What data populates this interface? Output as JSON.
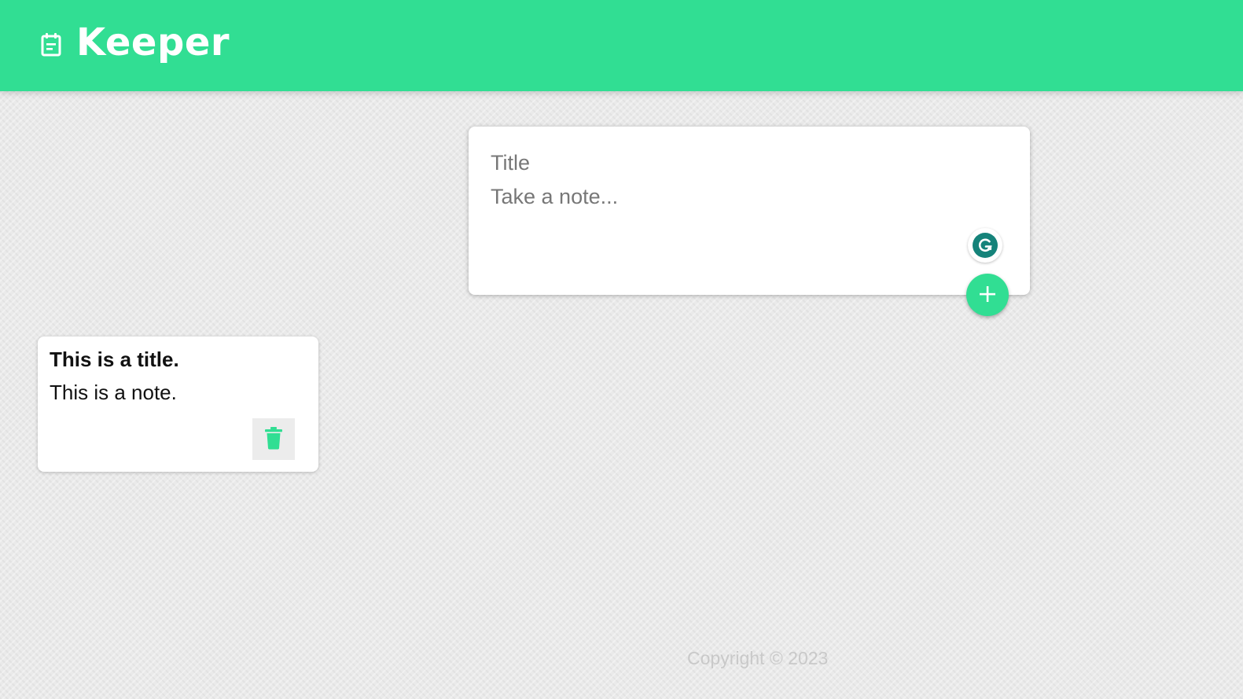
{
  "header": {
    "title": "Keeper",
    "icon": "note-icon"
  },
  "create_note": {
    "title_placeholder": "Title",
    "content_placeholder": "Take a note...",
    "grammarly_icon": "grammarly-icon",
    "add_icon": "plus-icon"
  },
  "notes": [
    {
      "title": "This is a title.",
      "content": "This is a note.",
      "delete_icon": "trash-icon"
    }
  ],
  "footer": {
    "text": "Copyright © 2023"
  },
  "colors": {
    "accent": "#31de93",
    "grammarly": "#15837a",
    "background": "#eaeaea"
  }
}
